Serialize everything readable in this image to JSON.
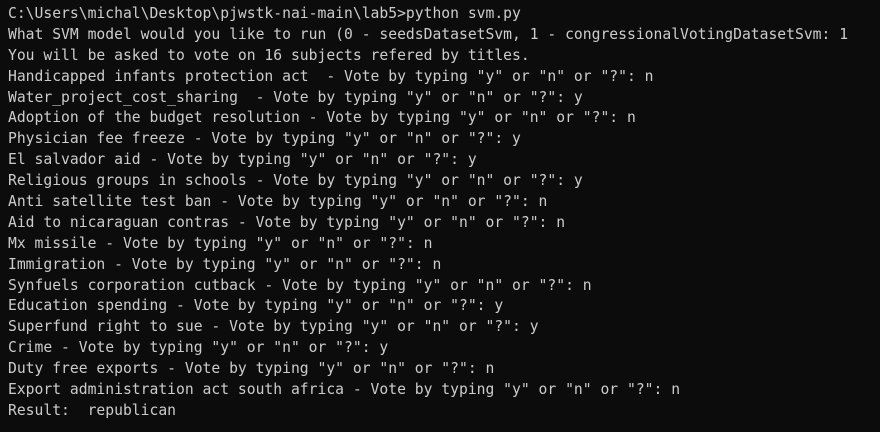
{
  "terminal": {
    "background": "#0c0c0c",
    "foreground": "#cccccc",
    "lines": [
      "C:\\Users\\michal\\Desktop\\pjwstk-nai-main\\lab5>python svm.py",
      "What SVM model would you like to run (0 - seedsDatasetSvm, 1 - congressionalVotingDatasetSvm: 1",
      "You will be asked to vote on 16 subjects refered by titles.",
      "Handicapped infants protection act  - Vote by typing \"y\" or \"n\" or \"?\": n",
      "Water_project_cost_sharing  - Vote by typing \"y\" or \"n\" or \"?\": y",
      "Adoption of the budget resolution - Vote by typing \"y\" or \"n\" or \"?\": n",
      "Physician fee freeze - Vote by typing \"y\" or \"n\" or \"?\": y",
      "El salvador aid - Vote by typing \"y\" or \"n\" or \"?\": y",
      "Religious groups in schools - Vote by typing \"y\" or \"n\" or \"?\": y",
      "Anti satellite test ban - Vote by typing \"y\" or \"n\" or \"?\": n",
      "Aid to nicaraguan contras - Vote by typing \"y\" or \"n\" or \"?\": n",
      "Mx missile - Vote by typing \"y\" or \"n\" or \"?\": n",
      "Immigration - Vote by typing \"y\" or \"n\" or \"?\": n",
      "Synfuels corporation cutback - Vote by typing \"y\" or \"n\" or \"?\": n",
      "Education spending - Vote by typing \"y\" or \"n\" or \"?\": y",
      "Superfund right to sue - Vote by typing \"y\" or \"n\" or \"?\": y",
      "Crime - Vote by typing \"y\" or \"n\" or \"?\": y",
      "Duty free exports - Vote by typing \"y\" or \"n\" or \"?\": n",
      "Export administration act south africa - Vote by typing \"y\" or \"n\" or \"?\": n",
      "Result:  republican"
    ]
  }
}
